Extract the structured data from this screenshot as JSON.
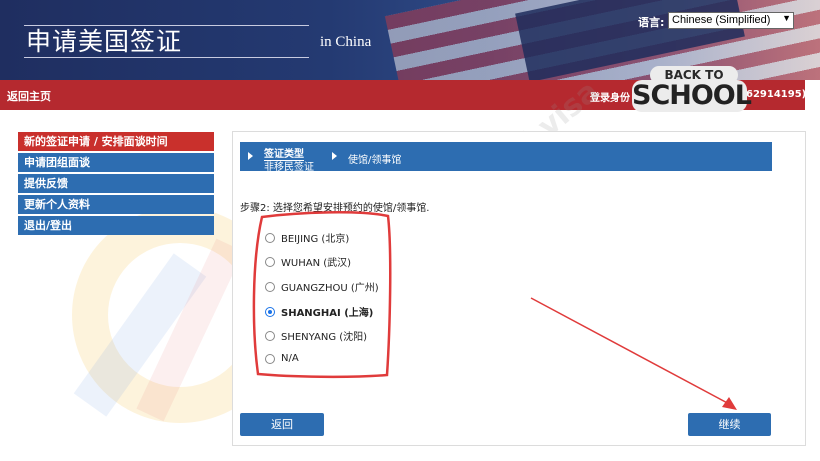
{
  "header": {
    "title": "申请美国签证",
    "subtitle": "in China",
    "language_label": "语言:",
    "language_value": "Chinese (Simplified)"
  },
  "topbar": {
    "home_link": "返回主页",
    "login_prefix": "登录身份",
    "login_suffix": "62914195)",
    "badge_top": "BACK TO",
    "badge_bottom": "SCHOOL"
  },
  "sidebar": {
    "items": [
      {
        "label": "新的签证申请 / 安排面谈时间",
        "active": true
      },
      {
        "label": "申请团组面谈"
      },
      {
        "label": "提供反馈"
      },
      {
        "label": "更新个人资料"
      },
      {
        "label": "退出/登出"
      }
    ]
  },
  "steps": {
    "step1_title": "签证类型",
    "step1_value": "非移民签证",
    "step2_title": "使馆/领事馆"
  },
  "main": {
    "prompt": "步骤2: 选择您希望安排预约的使馆/领事馆.",
    "options": [
      {
        "label": "BEIJING (北京)",
        "checked": false
      },
      {
        "label": "WUHAN (武汉)",
        "checked": false
      },
      {
        "label": "GUANGZHOU (广州)",
        "checked": false
      },
      {
        "label": "SHANGHAI (上海)",
        "checked": true
      },
      {
        "label": "SHENYANG (沈阳)",
        "checked": false
      },
      {
        "label": "N/A",
        "checked": false
      }
    ],
    "back_button": "返回",
    "continue_button": "继续"
  },
  "watermark": "125 visa",
  "colors": {
    "nav_blue": "#2d6db1",
    "header_red": "#b5292f",
    "active_red": "#c9302c",
    "annotation_red": "#e03b3b"
  }
}
